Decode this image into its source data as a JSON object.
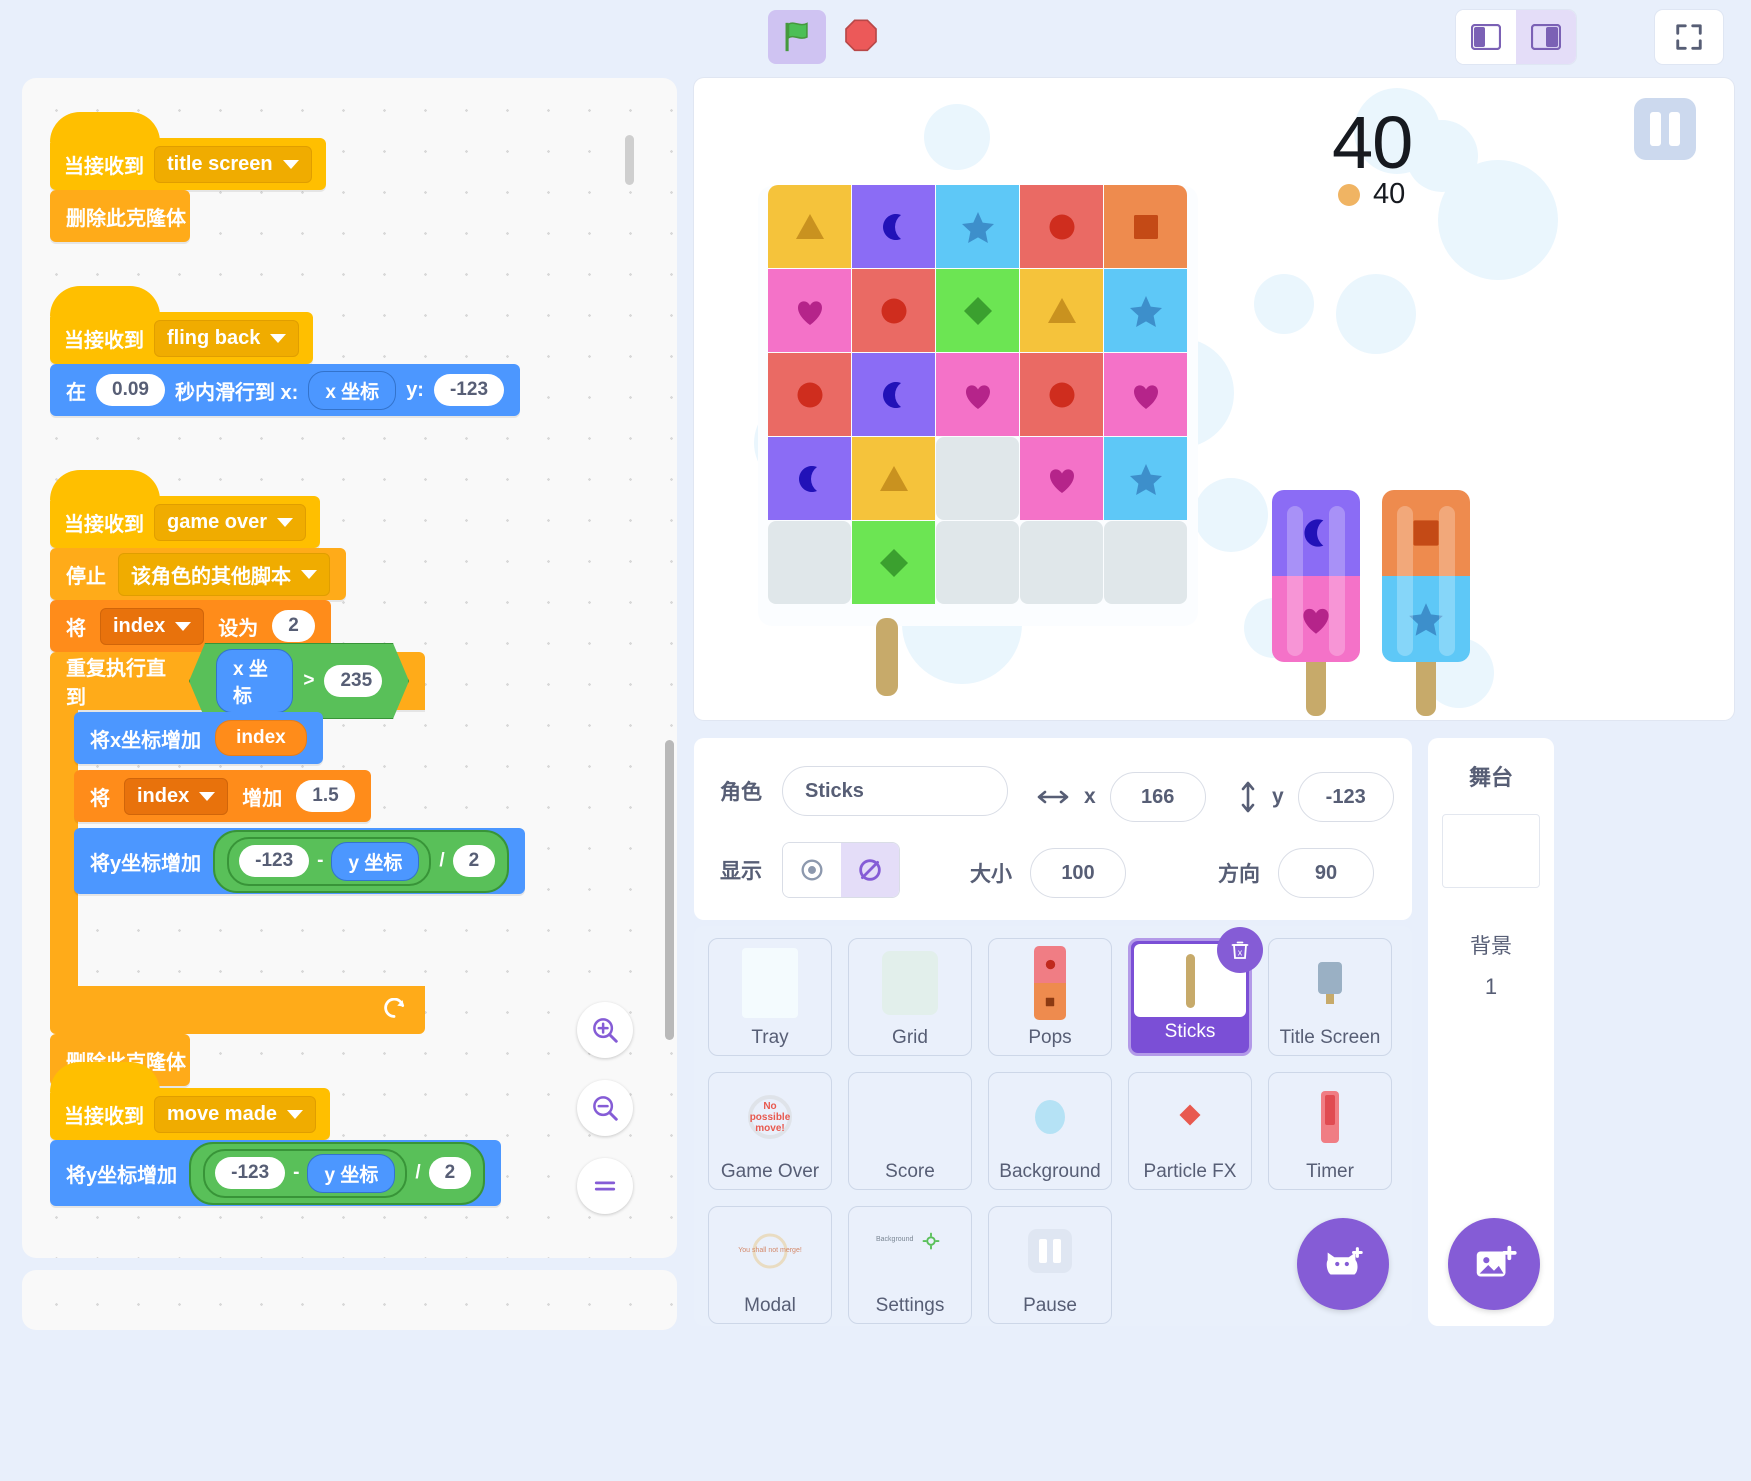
{
  "topbar": {
    "green_flag_icon": "green-flag-icon",
    "stop_icon": "stop-sign-icon",
    "layout_small_icon": "layout-small-stage-icon",
    "layout_large_icon": "layout-large-stage-icon",
    "fullscreen_icon": "fullscreen-icon"
  },
  "code": {
    "scripts": [
      {
        "hat_label": "当接收到",
        "hat_value": "title screen",
        "body": [
          {
            "label": "删除此克隆体"
          }
        ]
      },
      {
        "hat_label": "当接收到",
        "hat_value": "fling back",
        "glide": {
          "prefix": "在",
          "secs": "0.09",
          "mid": "秒内滑行到 x:",
          "x_var": "x 坐标",
          "ylabel": "y:",
          "y_val": "-123"
        }
      },
      {
        "hat_label": "当接收到",
        "hat_value": "game over",
        "stop_label": "停止",
        "stop_value": "该角色的其他脚本",
        "set_label": "将",
        "set_var": "index",
        "set_to": "设为",
        "set_val": "2",
        "repeat_label": "重复执行直到",
        "cond_left": "x 坐标",
        "cond_op": ">",
        "cond_right": "235",
        "changex_label": "将x坐标增加",
        "changex_val": "index",
        "changevar_label": "将",
        "changevar_var": "index",
        "changevar_by": "增加",
        "changevar_val": "1.5",
        "changey_label": "将y坐标增加",
        "changey_a": "-123",
        "changey_minus": "-",
        "changey_b": "y 坐标",
        "changey_div": "/",
        "changey_c": "2",
        "tail_label": "删除此克隆体"
      },
      {
        "hat_label": "当接收到",
        "hat_value": "move made",
        "changey_label": "将y坐标增加",
        "changey_a": "-123",
        "changey_minus": "-",
        "changey_b": "y 坐标",
        "changey_div": "/",
        "changey_c": "2"
      }
    ],
    "zoom_in_icon": "zoom-in-icon",
    "zoom_out_icon": "zoom-out-icon",
    "zoom_reset_icon": "zoom-reset-icon"
  },
  "stage": {
    "pause_icon": "pause-icon",
    "score_big": "40",
    "score_small": "40",
    "coin_icon": "coin-icon",
    "grid": [
      [
        {
          "bg": "#f5c33b",
          "shape": "triangle",
          "fg": "#c9921f"
        },
        {
          "bg": "#8b6cf5",
          "shape": "moon",
          "fg": "#2212b8"
        },
        {
          "bg": "#5ec8f7",
          "shape": "star",
          "fg": "#3d8fcb"
        },
        {
          "bg": "#ea6a64",
          "shape": "circle",
          "fg": "#cf2d1e"
        },
        {
          "bg": "#ee8b4e",
          "shape": "square",
          "fg": "#c44a16"
        }
      ],
      [
        {
          "bg": "#f472c8",
          "shape": "heart",
          "fg": "#b5248a"
        },
        {
          "bg": "#ea6a64",
          "shape": "circle",
          "fg": "#cf2d1e"
        },
        {
          "bg": "#6ce553",
          "shape": "diamond",
          "fg": "#3ba02f"
        },
        {
          "bg": "#f5c33b",
          "shape": "triangle",
          "fg": "#c9921f"
        },
        {
          "bg": "#5ec8f7",
          "shape": "star",
          "fg": "#3d8fcb"
        }
      ],
      [
        {
          "bg": "#ea6a64",
          "shape": "circle",
          "fg": "#cf2d1e"
        },
        {
          "bg": "#8b6cf5",
          "shape": "moon",
          "fg": "#2212b8"
        },
        {
          "bg": "#f472c8",
          "shape": "heart",
          "fg": "#b5248a"
        },
        {
          "bg": "#ea6a64",
          "shape": "circle",
          "fg": "#cf2d1e"
        },
        {
          "bg": "#f472c8",
          "shape": "heart",
          "fg": "#b5248a"
        }
      ],
      [
        {
          "bg": "#8b6cf5",
          "shape": "moon",
          "fg": "#2212b8"
        },
        {
          "bg": "#f5c33b",
          "shape": "triangle",
          "fg": "#c9921f"
        },
        {
          "bg": "empty",
          "shape": "none",
          "fg": ""
        },
        {
          "bg": "#f472c8",
          "shape": "heart",
          "fg": "#b5248a"
        },
        {
          "bg": "#5ec8f7",
          "shape": "star",
          "fg": "#3d8fcb"
        }
      ],
      [
        {
          "bg": "empty",
          "shape": "none",
          "fg": ""
        },
        {
          "bg": "#6ce553",
          "shape": "diamond",
          "fg": "#3ba02f"
        },
        {
          "bg": "empty",
          "shape": "none",
          "fg": ""
        },
        {
          "bg": "empty",
          "shape": "none",
          "fg": ""
        },
        {
          "bg": "empty",
          "shape": "none",
          "fg": ""
        }
      ]
    ],
    "pops": [
      {
        "top_bg": "#8b6cf5",
        "top_shape": "moon",
        "top_fg": "#2212b8",
        "bot_bg": "#f472c8",
        "bot_shape": "heart",
        "bot_fg": "#b5248a"
      },
      {
        "top_bg": "#ee8b4e",
        "top_shape": "square",
        "top_fg": "#c44a16",
        "bot_bg": "#5ec8f7",
        "bot_shape": "star",
        "bot_fg": "#3d8fcb"
      }
    ]
  },
  "info": {
    "sprite_label": "角色",
    "sprite_name": "Sticks",
    "x_label": "x",
    "x_value": "166",
    "y_label": "y",
    "y_value": "-123",
    "show_label": "显示",
    "show_icon": "eye-icon",
    "hide_icon": "eye-slash-icon",
    "size_label": "大小",
    "size_value": "100",
    "direction_label": "方向",
    "direction_value": "90",
    "x_arrow_icon": "horizontal-arrow-icon",
    "y_arrow_icon": "vertical-arrow-icon"
  },
  "sprites": [
    {
      "name": "Tray",
      "thumb": "tray",
      "selected": false
    },
    {
      "name": "Grid",
      "thumb": "grid",
      "selected": false
    },
    {
      "name": "Pops",
      "thumb": "pops",
      "selected": false
    },
    {
      "name": "Sticks",
      "thumb": "sticks",
      "selected": true
    },
    {
      "name": "Title Screen",
      "thumb": "titlescreen",
      "selected": false
    },
    {
      "name": "Game Over",
      "thumb": "gameover",
      "selected": false
    },
    {
      "name": "Score",
      "thumb": "score",
      "selected": false
    },
    {
      "name": "Background",
      "thumb": "background",
      "selected": false
    },
    {
      "name": "Particle FX",
      "thumb": "particlefx",
      "selected": false
    },
    {
      "name": "Timer",
      "thumb": "timer",
      "selected": false
    },
    {
      "name": "Modal",
      "thumb": "modal",
      "selected": false
    },
    {
      "name": "Settings",
      "thumb": "settings",
      "selected": false
    },
    {
      "name": "Pause",
      "thumb": "pause",
      "selected": false
    }
  ],
  "sprite_thumb_text": {
    "gameover": "No possible move!",
    "modal": "You shall not merge!",
    "settings": "Background"
  },
  "stage_panel": {
    "title": "舞台",
    "backdrop_label": "背景",
    "backdrop_count": "1"
  },
  "fabs": {
    "add_sprite_icon": "cat-add-icon",
    "add_backdrop_icon": "image-add-icon"
  },
  "delete_badge_icon": "trash-delete-icon",
  "colors": {
    "accent_purple": "#855cd6",
    "stage_bg": "#ffffff",
    "panel_bg": "#e9f0fb"
  }
}
